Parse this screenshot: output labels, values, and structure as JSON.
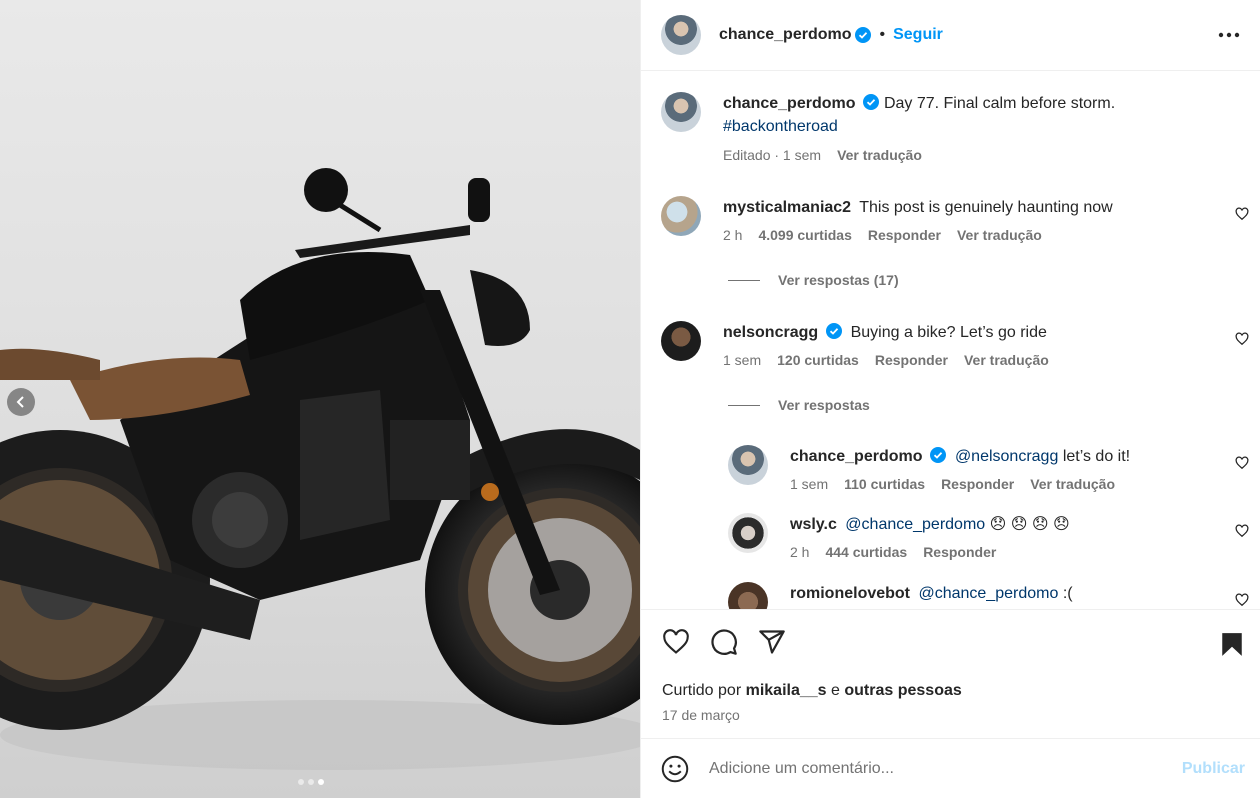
{
  "post": {
    "author": "chance_perdomo",
    "follow_label": "Seguir",
    "separator": "•",
    "caption": {
      "username": "chance_perdomo",
      "text": "Day 77. Final calm before storm.",
      "hashtag": "#backontheroad",
      "edited": "Editado · 1 sem",
      "translate": "Ver tradução"
    }
  },
  "comments": [
    {
      "username": "mysticalmaniac2",
      "text": "This post is genuinely haunting now",
      "time": "2 h",
      "likes": "4.099 curtidas",
      "reply": "Responder",
      "translate": "Ver tradução",
      "view_replies": "Ver respostas (17)"
    },
    {
      "username": "nelsoncragg",
      "text": "Buying a bike? Let’s go ride",
      "time": "1 sem",
      "likes": "120 curtidas",
      "reply": "Responder",
      "translate": "Ver tradução",
      "view_replies": "Ver respostas"
    }
  ],
  "replies": [
    {
      "username": "chance_perdomo",
      "mention": "@nelsoncragg",
      "text": "let’s do it!",
      "time": "1 sem",
      "likes": "110 curtidas",
      "reply": "Responder",
      "translate": "Ver tradução"
    },
    {
      "username": "wsly.c",
      "mention": "@chance_perdomo",
      "text": "😞 😞 😞 😞",
      "time": "2 h",
      "likes": "444 curtidas",
      "reply": "Responder"
    },
    {
      "username": "romionelovebot",
      "mention": "@chance_perdomo",
      "text": ":("
    }
  ],
  "likes_summary": {
    "prefix": "Curtido por",
    "user": "mikaila__s",
    "middle": "e",
    "others": "outras pessoas"
  },
  "date": "17 de março",
  "composer": {
    "placeholder": "Adicione um comentário...",
    "publish": "Publicar"
  },
  "carousel": {
    "count": 3,
    "active_index": 2
  },
  "colors": {
    "accent": "#0095f6",
    "verified": "#0095f6",
    "link": "#00376b",
    "muted": "#737373"
  }
}
